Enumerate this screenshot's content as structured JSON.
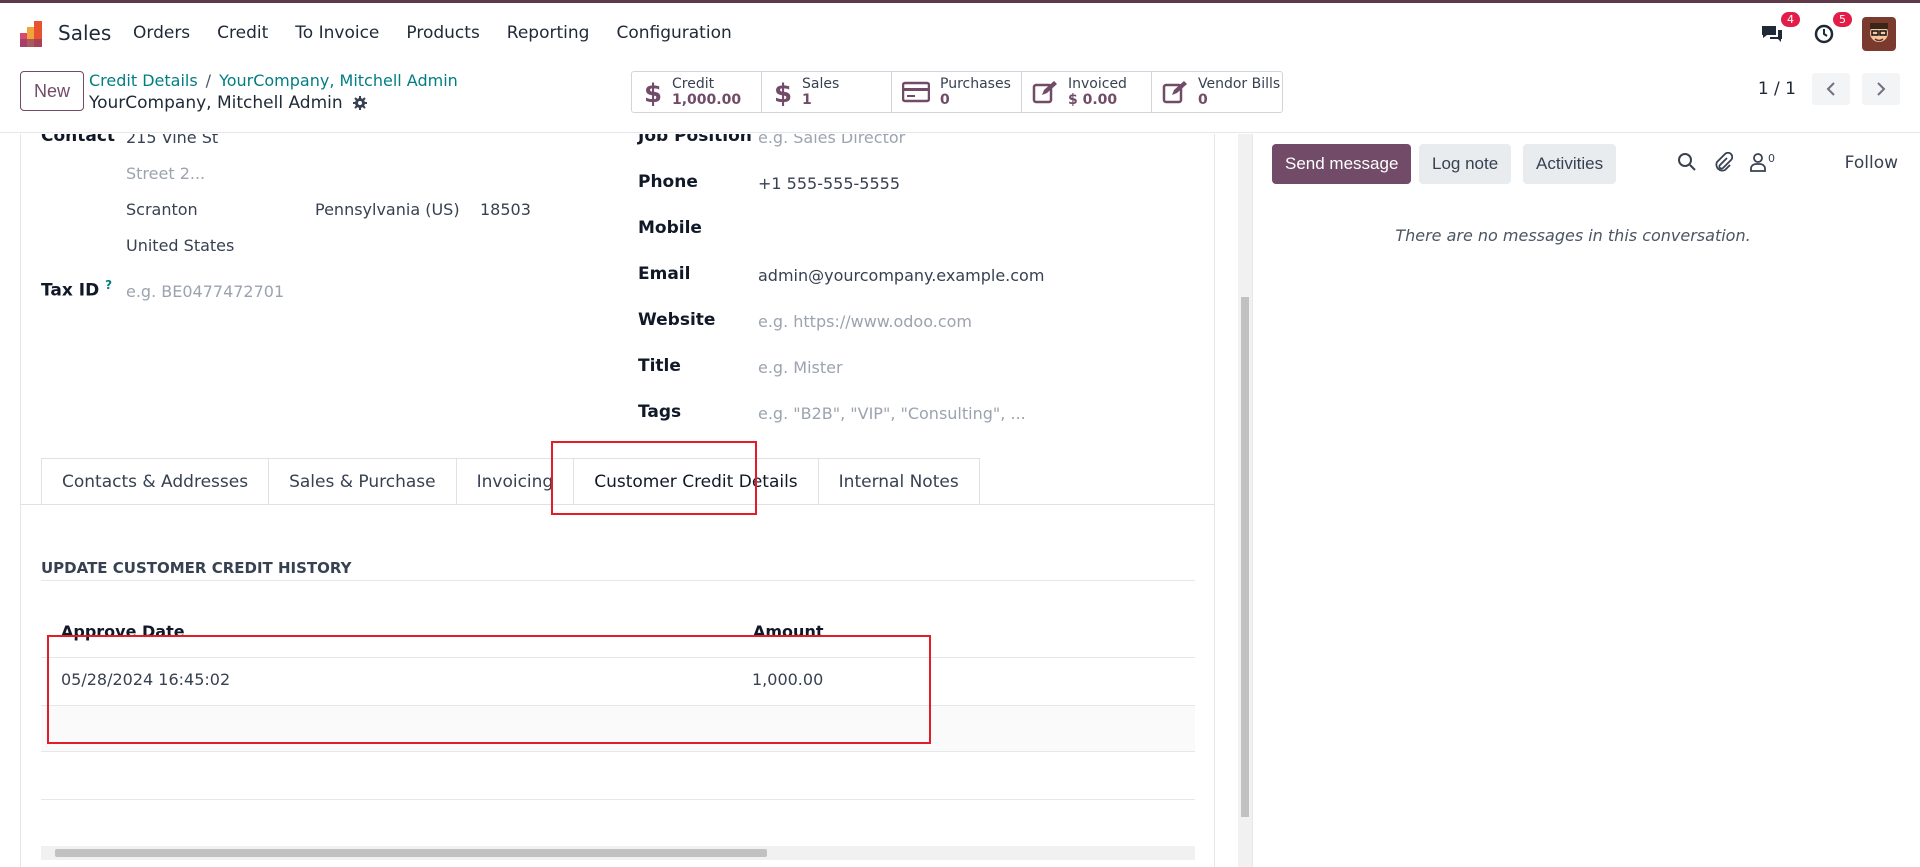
{
  "app": {
    "name": "Sales"
  },
  "menu": [
    "Orders",
    "Credit",
    "To Invoice",
    "Products",
    "Reporting",
    "Configuration"
  ],
  "systray": {
    "messages_count": "4",
    "activities_count": "5"
  },
  "control": {
    "new_label": "New",
    "breadcrumb": [
      "Credit Details",
      "YourCompany, Mitchell Admin"
    ],
    "breadcrumb_sep": "/",
    "record_name": "YourCompany, Mitchell Admin",
    "pager": "1 / 1"
  },
  "smart_buttons": [
    {
      "label": "Credit",
      "value": "1,000.00",
      "icon": "dollar-icon"
    },
    {
      "label": "Sales",
      "value": "1",
      "icon": "dollar-icon"
    },
    {
      "label": "Purchases",
      "value": "0",
      "icon": "credit-card-icon"
    },
    {
      "label": "Invoiced",
      "value": "$ 0.00",
      "icon": "pencil-square-icon"
    },
    {
      "label": "Vendor Bills",
      "value": "0",
      "icon": "pencil-square-icon"
    }
  ],
  "form": {
    "contact_label": "Contact",
    "street": "215 Vine St",
    "street2_placeholder": "Street 2...",
    "city": "Scranton",
    "state": "Pennsylvania (US)",
    "zip": "18503",
    "country": "United States",
    "taxid_label": "Tax ID",
    "taxid_help": "?",
    "taxid_placeholder": "e.g. BE0477472701",
    "job_label": "Job Position",
    "job_placeholder": "e.g. Sales Director",
    "phone_label": "Phone",
    "phone": "+1 555-555-5555",
    "mobile_label": "Mobile",
    "email_label": "Email",
    "email": "admin@yourcompany.example.com",
    "website_label": "Website",
    "website_placeholder": "e.g. https://www.odoo.com",
    "title_label": "Title",
    "title_placeholder": "e.g. Mister",
    "tags_label": "Tags",
    "tags_placeholder": "e.g. \"B2B\", \"VIP\", \"Consulting\", ..."
  },
  "tabs": [
    "Contacts & Addresses",
    "Sales & Purchase",
    "Invoicing",
    "Customer Credit Details",
    "Internal Notes"
  ],
  "active_tab": "Customer Credit Details",
  "credit_history": {
    "title": "UPDATE CUSTOMER CREDIT HISTORY",
    "columns": [
      "Approve Date",
      "Amount"
    ],
    "rows": [
      {
        "date": "05/28/2024 16:45:02",
        "amount": "1,000.00"
      }
    ]
  },
  "chatter": {
    "send_message": "Send message",
    "log_note": "Log note",
    "activities": "Activities",
    "followers_count": "0",
    "follow": "Follow",
    "empty": "There are no messages in this conversation."
  },
  "colors": {
    "brand": "#714b67",
    "link": "#017e84",
    "highlight": "#e11d2a"
  }
}
